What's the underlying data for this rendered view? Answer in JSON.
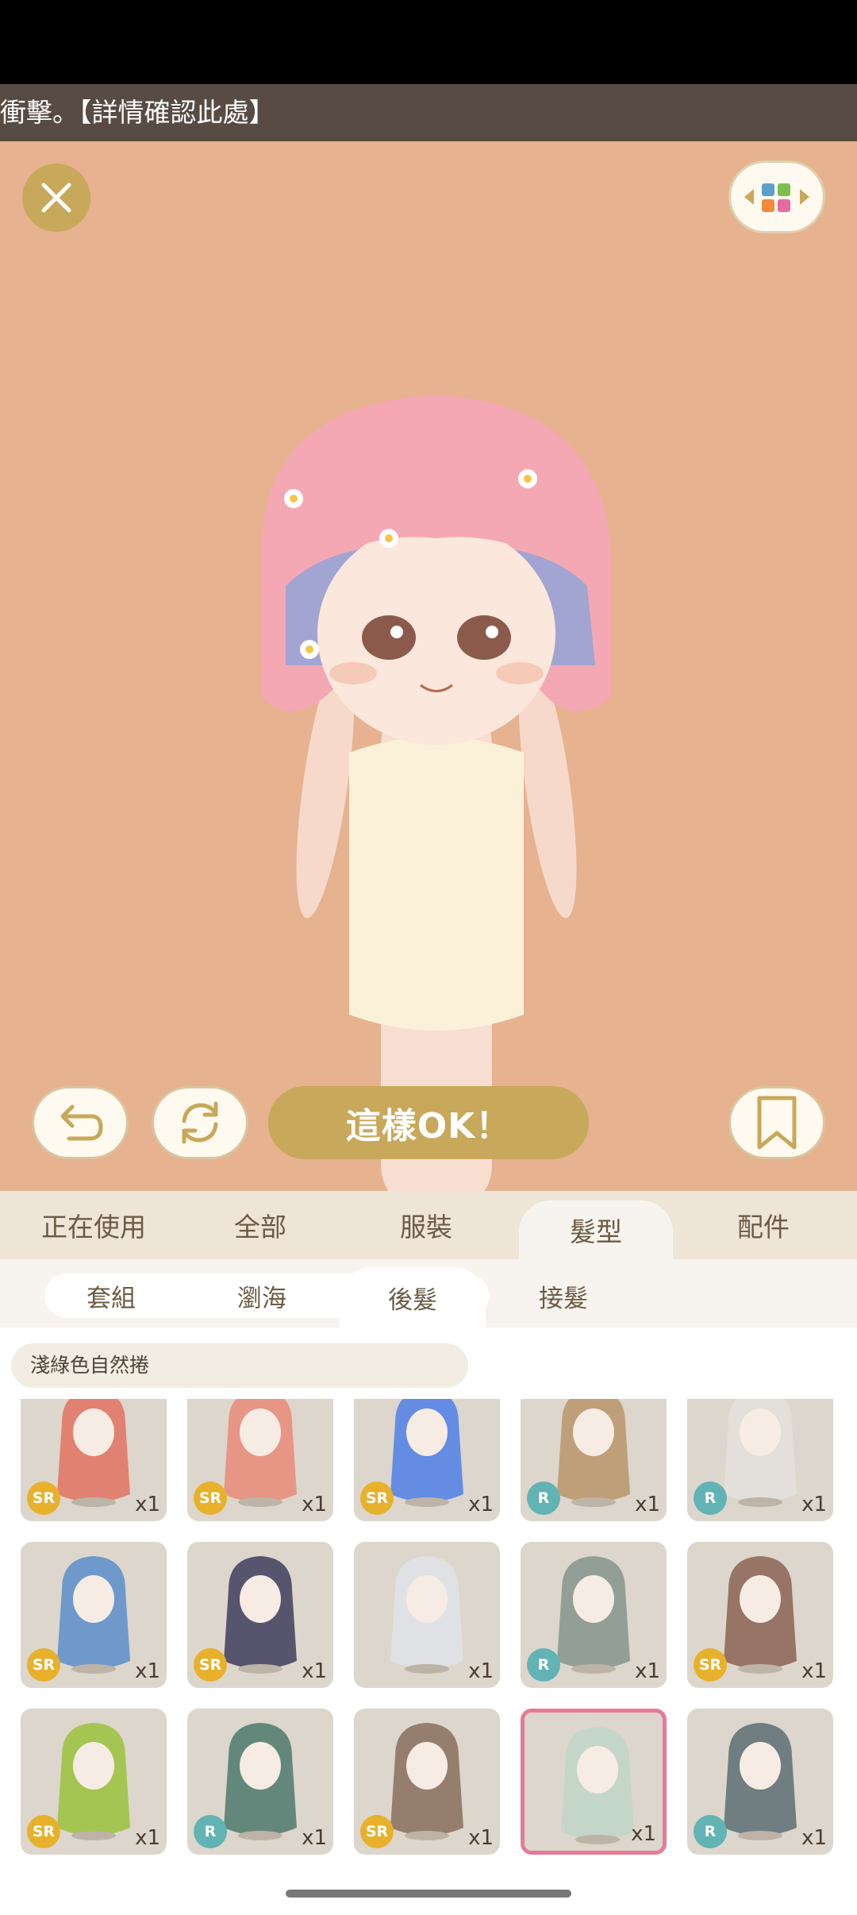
{
  "ticker": {
    "text": "衝擊。【詳情確認此處】"
  },
  "stage": {
    "ok_label": "這樣OK！"
  },
  "tabs": [
    {
      "label": "正在使用"
    },
    {
      "label": "全部"
    },
    {
      "label": "服裝"
    },
    {
      "label": "髮型"
    },
    {
      "label": "配件"
    }
  ],
  "active_tab": "髮型",
  "subtabs": [
    {
      "label": "套組"
    },
    {
      "label": "瀏海"
    },
    {
      "label": "後髮"
    },
    {
      "label": "接髮"
    }
  ],
  "active_subtab": "後髮",
  "filter": {
    "label": "淺綠色自然捲"
  },
  "items": [
    {
      "rarity": "SR",
      "qty": "x1",
      "color": "#e27262"
    },
    {
      "rarity": "SR",
      "qty": "x1",
      "color": "#e98a78"
    },
    {
      "rarity": "SR",
      "qty": "x1",
      "color": "#4f7fe6"
    },
    {
      "rarity": "R",
      "qty": "x1",
      "color": "#b8956a"
    },
    {
      "rarity": "R",
      "qty": "x1",
      "color": "#e4e1dc"
    },
    {
      "rarity": "SR",
      "qty": "x1",
      "color": "#5b8ec9"
    },
    {
      "rarity": "SR",
      "qty": "x1",
      "color": "#3f3d5c"
    },
    {
      "rarity": "",
      "qty": "x1",
      "color": "#e0e3e8"
    },
    {
      "rarity": "R",
      "qty": "x1",
      "color": "#86958c"
    },
    {
      "rarity": "SR",
      "qty": "x1",
      "color": "#8b6352"
    },
    {
      "rarity": "SR",
      "qty": "x1",
      "color": "#9bc23c"
    },
    {
      "rarity": "R",
      "qty": "x1",
      "color": "#4e7a6c"
    },
    {
      "rarity": "SR",
      "qty": "x1",
      "color": "#8a6e5e"
    },
    {
      "rarity": "",
      "qty": "x1",
      "color": "#bfd6c7"
    },
    {
      "rarity": "R",
      "qty": "x1",
      "color": "#5d6f74"
    }
  ],
  "selected_item_index": 13,
  "colors": {
    "stage_bg": "#e6b290",
    "gold": "#c8a85a",
    "tab_bg": "#efe5d6",
    "sr_badge": "#e7b12c",
    "r_badge": "#62b3b3",
    "selected_border": "#e57b97"
  }
}
